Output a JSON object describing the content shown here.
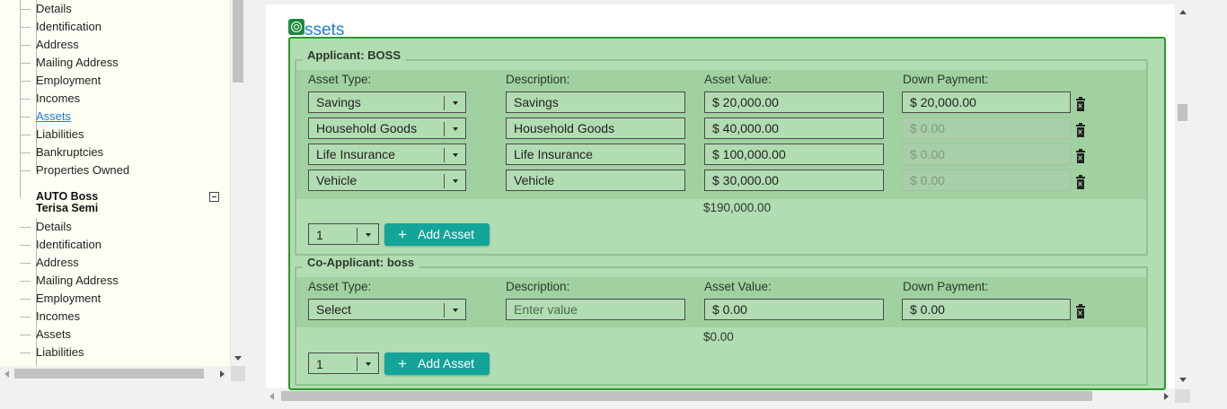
{
  "tree": {
    "first_group_items": [
      "Details",
      "Identification",
      "Address",
      "Mailing Address",
      "Employment",
      "Incomes",
      "Assets",
      "Liabilities",
      "Bankruptcies",
      "Properties Owned"
    ],
    "second_parent_line1": "AUTO Boss",
    "second_parent_line2": "Terisa Semi",
    "second_group_items": [
      "Details",
      "Identification",
      "Address",
      "Mailing Address",
      "Employment",
      "Incomes",
      "Assets",
      "Liabilities"
    ]
  },
  "section": {
    "title_suffix": "ssets"
  },
  "columns": {
    "asset_type": "Asset Type:",
    "description": "Description:",
    "asset_value": "Asset Value:",
    "down_payment": "Down Payment:"
  },
  "applicant": {
    "legend": "Applicant: BOSS",
    "rows": [
      {
        "type": "Savings",
        "description": "Savings",
        "value": "$ 20,000.00",
        "down_payment": "$ 20,000.00"
      },
      {
        "type": "Household Goods",
        "description": "Household Goods",
        "value": "$ 40,000.00",
        "down_payment": "$ 0.00"
      },
      {
        "type": "Life Insurance",
        "description": "Life Insurance",
        "value": "$ 100,000.00",
        "down_payment": "$ 0.00"
      },
      {
        "type": "Vehicle",
        "description": "Vehicle",
        "value": "$ 30,000.00",
        "down_payment": "$ 0.00"
      }
    ],
    "total": "$190,000.00",
    "quantity": "1",
    "add_label": "Add Asset"
  },
  "co_applicant": {
    "legend": "Co-Applicant: boss",
    "rows": [
      {
        "type": "Select",
        "description_placeholder": "Enter value",
        "value": "$ 0.00",
        "down_payment": "$ 0.00"
      }
    ],
    "total": "$0.00",
    "quantity": "1",
    "add_label": "Add Asset"
  },
  "colors": {
    "panel_bg": "#b2dcb2",
    "panel_border": "#2a9a2a",
    "add_button": "#13a49a",
    "link": "#1a7fd4"
  }
}
